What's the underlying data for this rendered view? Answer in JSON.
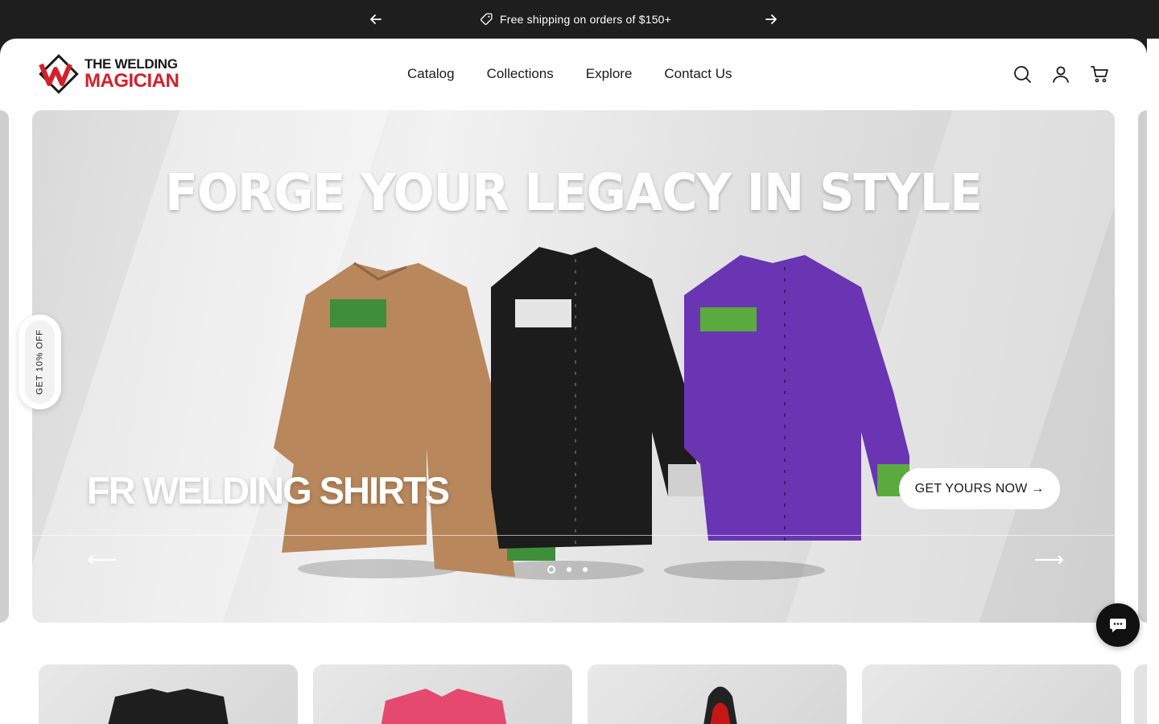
{
  "announcement": {
    "message": "Free shipping on orders of $150+",
    "prev_icon": "arrow-left-icon",
    "next_icon": "arrow-right-icon"
  },
  "header": {
    "logo_line1": "THE WELDING",
    "logo_line2": "MAGICIAN",
    "nav": [
      "Catalog",
      "Collections",
      "Explore",
      "Contact Us"
    ],
    "icons": [
      "search-icon",
      "account-icon",
      "cart-icon"
    ]
  },
  "hero": {
    "title": "FORGE YOUR LEGACY IN STYLE",
    "subtitle": "FR WELDING SHIRTS",
    "cta_label": "GET YOURS NOW →",
    "prev_arrow": "⟵",
    "next_arrow": "⟶",
    "slides_total": 3,
    "active_slide": 1
  },
  "discount_tab": {
    "label": "GET 10% OFF"
  },
  "chat": {
    "icon": "chat-bubble-icon"
  },
  "colors": {
    "brand_red": "#d4202a",
    "announce_bg": "#1e1e1e"
  }
}
